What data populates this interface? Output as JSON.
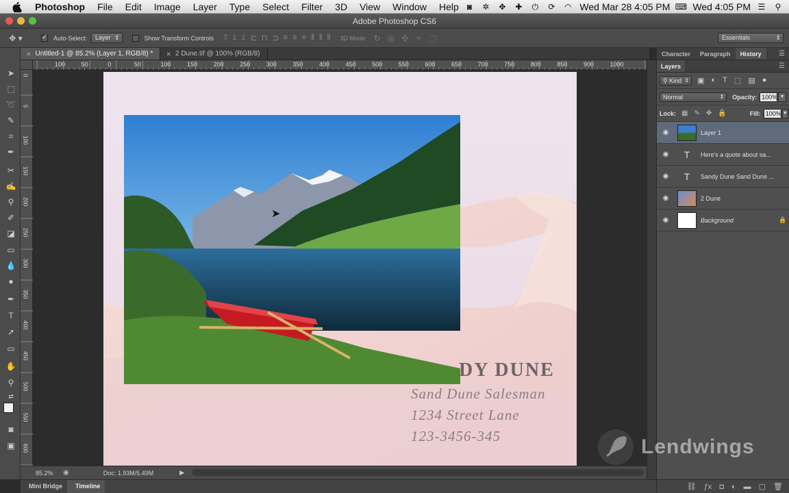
{
  "menubar": {
    "app": "Photoshop",
    "items": [
      "File",
      "Edit",
      "Image",
      "Layer",
      "Type",
      "Select",
      "Filter",
      "3D",
      "View",
      "Window",
      "Help"
    ],
    "status": {
      "date_time": "Wed Mar 28  4:05 PM",
      "clock": "Wed 4:05 PM"
    }
  },
  "window": {
    "title": "Adobe Photoshop CS6"
  },
  "options": {
    "autoselect_label": "Auto-Select:",
    "autoselect_value": "Layer",
    "transform_label": "Show Transform Controls",
    "mode3d_label": "3D Mode:",
    "workspace": "Essentials"
  },
  "doc_tabs": [
    {
      "label": "Untitled-1 @ 85.2% (Layer 1, RGB/8) *",
      "active": true
    },
    {
      "label": "2 Dune.tif @ 100% (RGB/8)",
      "active": false
    }
  ],
  "ruler": {
    "h_labels": [
      "100",
      "50",
      "0",
      "50",
      "100",
      "150",
      "200",
      "250",
      "300",
      "350",
      "400",
      "450",
      "500",
      "550",
      "600",
      "650",
      "700",
      "750",
      "800",
      "850",
      "900",
      "1000"
    ],
    "v_labels": [
      "0",
      "5",
      "1 0 0",
      "1 5 0",
      "2 0 0",
      "2 5 0",
      "3 0 0",
      "3 5 0",
      "4 0 0",
      "4 5 0",
      "5 0 0",
      "5 5 0",
      "6 0 0",
      "6 5 0"
    ]
  },
  "document": {
    "quote_name": "DY DUNE",
    "quote_line1": "Sand Dune Salesman",
    "quote_line2": "1234 Street Lane",
    "quote_line3": "123-3456-345"
  },
  "status": {
    "zoom": "85.2%",
    "doc_size": "Doc: 1.93M/5.49M"
  },
  "bottom_tabs": [
    "Mini Bridge",
    "Timeline"
  ],
  "panel": {
    "top_tabs": [
      "Character",
      "Paragraph",
      "History"
    ],
    "layers_tab": "Layers",
    "filter_kind": "Kind",
    "blend_mode": "Normal",
    "opacity_label": "Opacity:",
    "opacity_value": "100%",
    "lock_label": "Lock:",
    "fill_label": "Fill:",
    "fill_value": "100%",
    "layers": [
      {
        "name": "Layer 1",
        "type": "image",
        "selected": true
      },
      {
        "name": "Here's a quote about sa...",
        "type": "text",
        "selected": false
      },
      {
        "name": "Sandy Dune Sand Dune ...",
        "type": "text",
        "selected": false
      },
      {
        "name": "2 Dune",
        "type": "image",
        "selected": false
      },
      {
        "name": "Background",
        "type": "background",
        "selected": false
      }
    ]
  },
  "watermark": {
    "text": "Lendwings"
  },
  "colors": {
    "accent": "#5f6a7a",
    "panel_bg": "#4f4f4f",
    "canvas_bg": "#2c2c2c"
  }
}
